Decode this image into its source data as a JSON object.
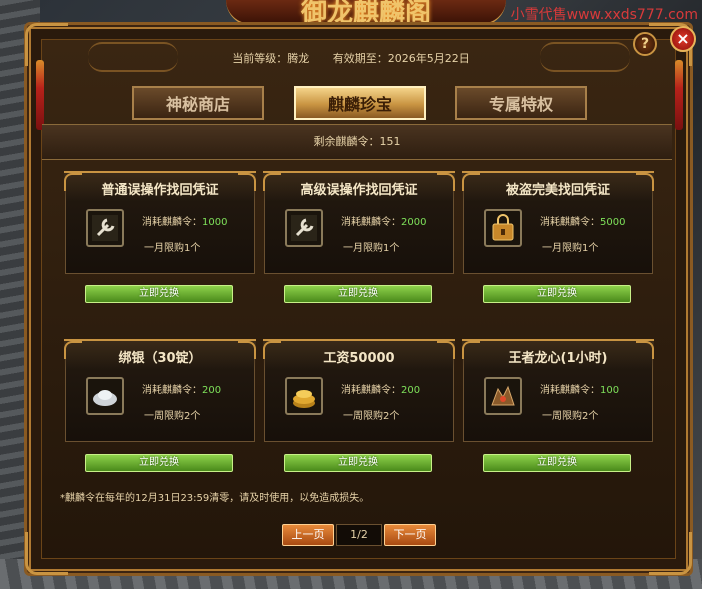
{
  "watermark": "小雪代售www.xxds777.com",
  "window_title": "御龙麒麟阁",
  "header": {
    "level_label": "当前等级：腾龙",
    "expiry_label": "有效期至：2026年5月22日"
  },
  "tabs": [
    {
      "label": "神秘商店",
      "active": false
    },
    {
      "label": "麒麟珍宝",
      "active": true
    },
    {
      "label": "专属特权",
      "active": false
    }
  ],
  "remaining": "剩余麒麟令：151",
  "items": [
    {
      "title": "普通误操作找回凭证",
      "icon": "wrench-icon",
      "cost_label": "消耗麒麟令：",
      "cost_value": "1000",
      "limit": "一月限购1个",
      "button": "立即兑换"
    },
    {
      "title": "高级误操作找回凭证",
      "icon": "wrench-icon",
      "cost_label": "消耗麒麟令：",
      "cost_value": "2000",
      "limit": "一月限购1个",
      "button": "立即兑换"
    },
    {
      "title": "被盗完美找回凭证",
      "icon": "lockbox-icon",
      "cost_label": "消耗麒麟令：",
      "cost_value": "5000",
      "limit": "一月限购1个",
      "button": "立即兑换"
    },
    {
      "title": "绑银（30锭）",
      "icon": "silver-ingot-icon",
      "cost_label": "消耗麒麟令：",
      "cost_value": "200",
      "limit": "一周限购2个",
      "button": "立即兑换"
    },
    {
      "title": "工资50000",
      "icon": "gold-coins-icon",
      "cost_label": "消耗麒麟令：",
      "cost_value": "200",
      "limit": "一周限购2个",
      "button": "立即兑换"
    },
    {
      "title": "王者龙心(1小时)",
      "icon": "dragon-heart-icon",
      "cost_label": "消耗麒麟令：",
      "cost_value": "100",
      "limit": "一周限购2个",
      "button": "立即兑换"
    }
  ],
  "notice": "*麒麟令在每年的12月31日23:59清零，请及时使用，以免造成损失。",
  "pagination": {
    "prev": "上一页",
    "page": "1/2",
    "next": "下一页"
  },
  "colors": {
    "accent_gold": "#c99442",
    "cost_green": "#7ee05a",
    "button_green": "#6aae2e",
    "page_orange": "#d0702a",
    "close_red": "#c8221a"
  }
}
